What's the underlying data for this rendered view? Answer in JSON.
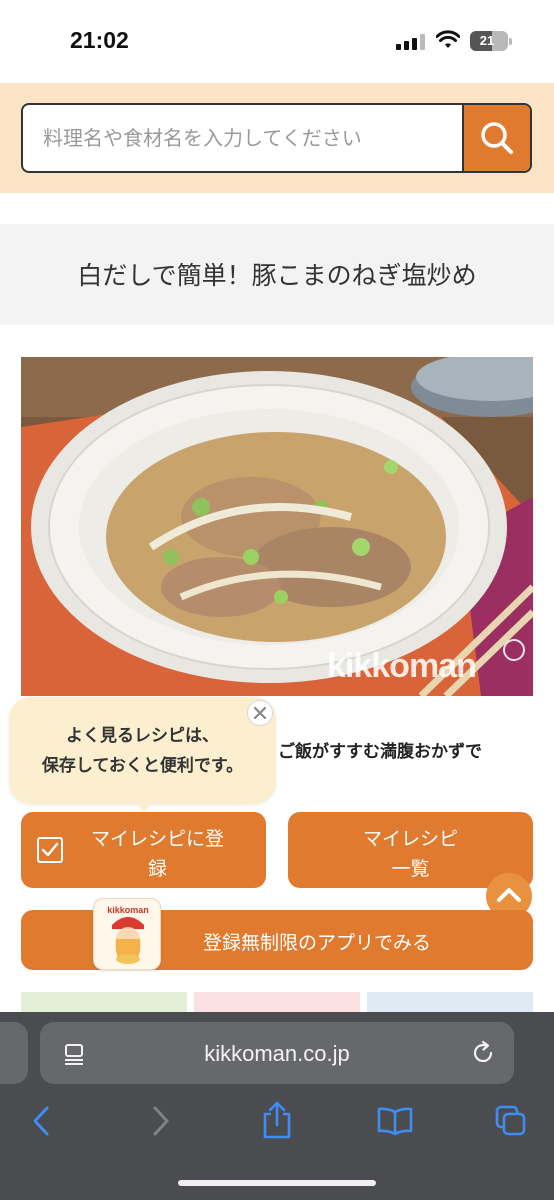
{
  "status_bar": {
    "time": "21:02",
    "battery_percent": "21"
  },
  "search": {
    "placeholder": "料理名や食材名を入力してください",
    "button_icon": "search-icon"
  },
  "recipe": {
    "title": "白だしで簡単！豚こまのねぎ塩炒め",
    "photo_watermark": "kikkoman",
    "description_visible": "ご飯がすすむ満腹おかずで"
  },
  "tooltip": {
    "line1": "よく見るレシピは、",
    "line2": "保存しておくと便利です。",
    "close_icon": "close-icon"
  },
  "buttons": {
    "my_recipe_line1": "マイレシピに登",
    "my_recipe_line2": "録",
    "my_recipe_list_line1": "マイレシピ",
    "my_recipe_list_line2": "一覧",
    "app_label": "登録無制限のアプリでみる",
    "app_icon_brand": "kikkoman"
  },
  "browser": {
    "url": "kikkoman.co.jp",
    "toolbar_icons": [
      "back-icon",
      "forward-icon",
      "share-icon",
      "bookmarks-icon",
      "tabs-icon"
    ]
  },
  "colors": {
    "accent_orange": "#e07a2e",
    "search_band": "#fbe4c6",
    "tooltip_bg": "#fcefcf",
    "safari_bar": "#4b4c4f"
  }
}
